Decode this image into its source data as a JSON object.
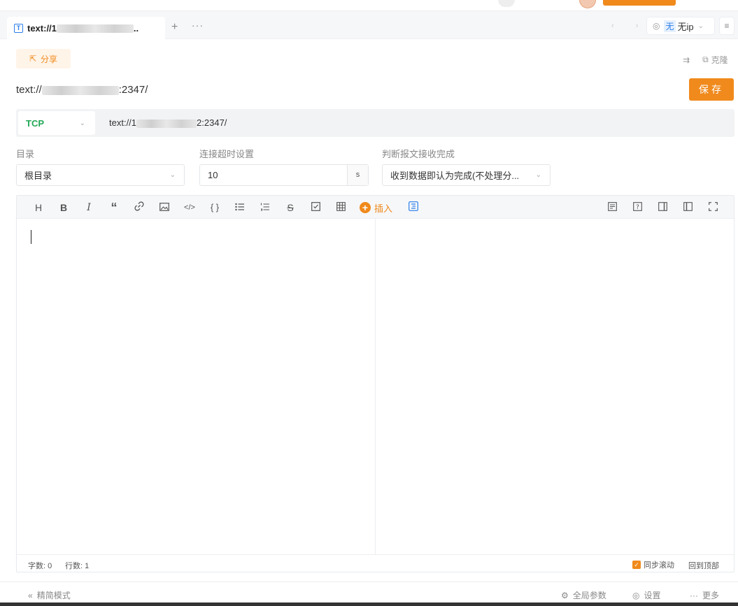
{
  "tab": {
    "title_prefix": "text://1",
    "title_suffix": "..",
    "icon": "text-file-icon",
    "add": "+",
    "more": "···"
  },
  "env": {
    "badge": "无",
    "name": "无ip"
  },
  "share": {
    "label": "分享"
  },
  "tools": {
    "clone": "克隆"
  },
  "url": {
    "prefix": "text://",
    "suffix": ":2347/"
  },
  "save": {
    "label": "保存"
  },
  "protocol": {
    "selected": "TCP",
    "url_prefix": "text://1",
    "url_suffix": "2:2347/"
  },
  "settings": {
    "dir_label": "目录",
    "dir_value": "根目录",
    "timeout_label": "连接超时设置",
    "timeout_value": "10",
    "timeout_unit": "s",
    "complete_label": "判断报文接收完成",
    "complete_value": "收到数据即认为完成(不处理分..."
  },
  "toolbar": {
    "items": [
      "H",
      "B",
      "I",
      "“",
      "link-icon",
      "image-icon",
      "</>",
      "{ }",
      "bullet-list-icon",
      "ordered-list-icon",
      "strikethrough-icon",
      "checkbox-icon",
      "table-icon"
    ],
    "insert_label": "插入"
  },
  "footer": {
    "chars": "字数: 0",
    "lines": "行数: 1",
    "sync": "同步滚动",
    "back_top": "回到顶部"
  },
  "bottom": {
    "simple": "精简模式",
    "global_params": "全局参数",
    "settings": "设置",
    "more": "更多"
  },
  "colors": {
    "accent": "#f08a1c",
    "tcp": "#23a857",
    "link_blue": "#2b7de9"
  }
}
